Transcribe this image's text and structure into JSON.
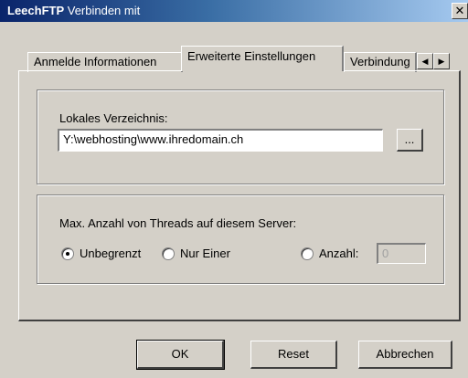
{
  "window": {
    "title_app": "LeechFTP",
    "title_rest": " Verbinden mit",
    "close_glyph": "✕"
  },
  "tabs": [
    {
      "label": "Anmelde Informationen",
      "active": false
    },
    {
      "label": "Erweiterte Einstellungen",
      "active": true
    },
    {
      "label": "Verbindung",
      "active": false
    }
  ],
  "tab_scroll": {
    "left_glyph": "◀",
    "right_glyph": "▶"
  },
  "local_dir": {
    "label": "Lokales Verzeichnis:",
    "value": "Y:\\webhosting\\www.ihredomain.ch",
    "browse_label": "..."
  },
  "threads": {
    "label": "Max. Anzahl von Threads auf diesem Server:",
    "options": [
      {
        "label": "Unbegrenzt",
        "checked": true
      },
      {
        "label": "Nur Einer",
        "checked": false
      },
      {
        "label": "Anzahl:",
        "checked": false
      }
    ],
    "count_value": "0"
  },
  "buttons": {
    "ok": "OK",
    "reset": "Reset",
    "cancel": "Abbrechen"
  }
}
